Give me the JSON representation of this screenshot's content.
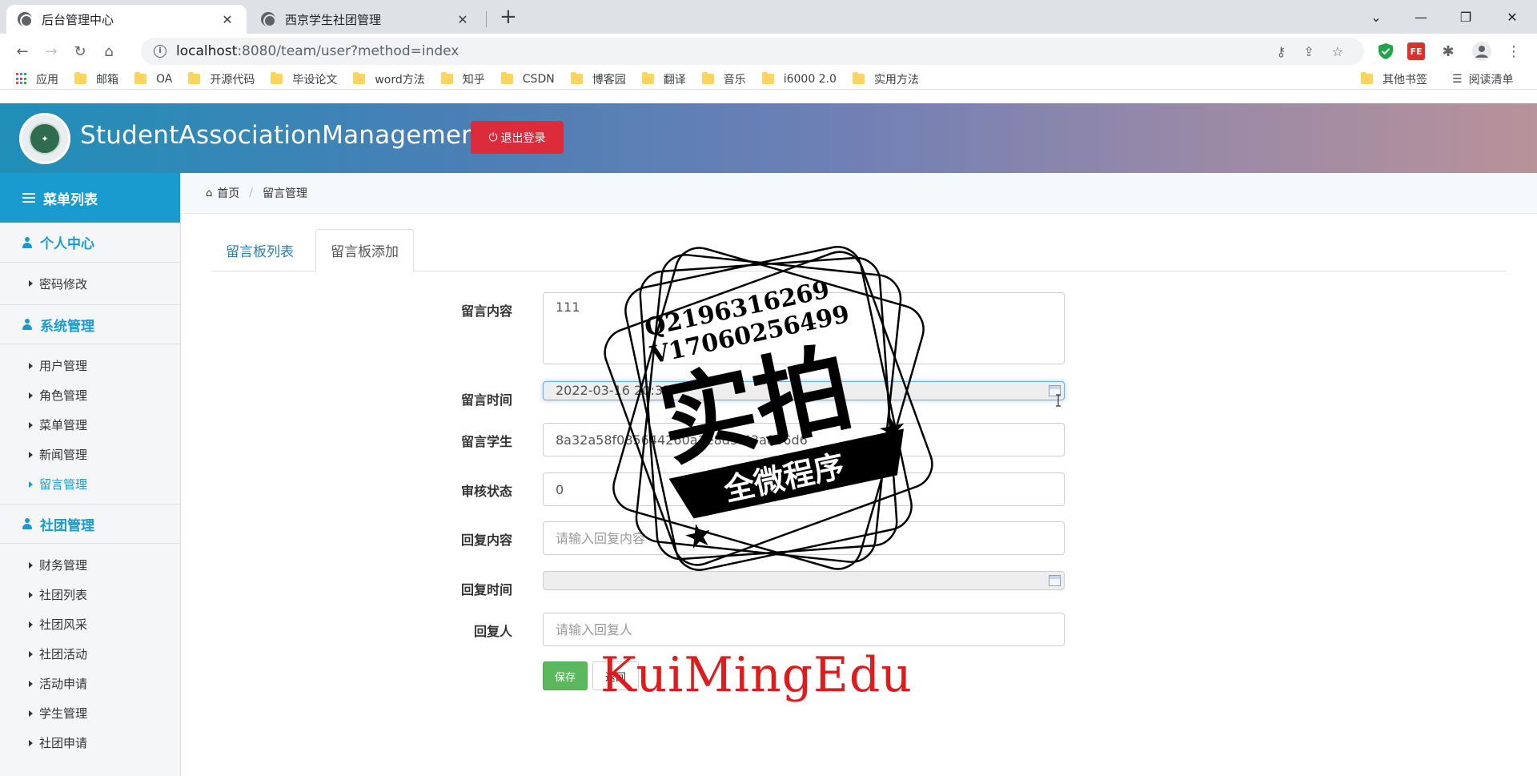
{
  "browser": {
    "tabs": [
      {
        "title": "后台管理中心",
        "active": true
      },
      {
        "title": "西京学生社团管理",
        "active": false
      }
    ],
    "url_host": "localhost",
    "url_path": ":8080/team/user?method=index",
    "bookmarks": [
      "应用",
      "邮箱",
      "OA",
      "开源代码",
      "毕设论文",
      "word方法",
      "知乎",
      "CSDN",
      "博客园",
      "翻译",
      "音乐",
      "i6000 2.0",
      "实用方法"
    ],
    "bookmarks_right": [
      "其他书签",
      "阅读清单"
    ],
    "ext_fe": "FE"
  },
  "header": {
    "brand": "StudentAssociationManagement",
    "logout_label": "退出登录"
  },
  "sidebar": {
    "menu_title": "菜单列表",
    "groups": [
      {
        "title": "个人中心",
        "items": [
          "密码修改"
        ]
      },
      {
        "title": "系统管理",
        "items": [
          "用户管理",
          "角色管理",
          "菜单管理",
          "新闻管理",
          "留言管理"
        ]
      },
      {
        "title": "社团管理",
        "items": [
          "财务管理",
          "社团列表",
          "社团风采",
          "社团活动",
          "活动申请",
          "学生管理",
          "社团申请"
        ]
      }
    ],
    "active_item": "留言管理"
  },
  "breadcrumb": {
    "home": "首页",
    "current": "留言管理"
  },
  "tabs": {
    "list": "留言板列表",
    "add": "留言板添加"
  },
  "form": {
    "content_label": "留言内容",
    "content_value": "111",
    "time_label": "留言时间",
    "time_value": "2022-03-16 20:35",
    "student_label": "留言学生",
    "student_value": "8a32a58f085644260a1e8d3f43a866d6",
    "status_label": "审核状态",
    "status_value": "0",
    "reply_label": "回复内容",
    "reply_placeholder": "请输入回复内容",
    "reply_time_label": "回复时间",
    "replier_label": "回复人",
    "replier_placeholder": "请输入回复人",
    "save_label": "保存",
    "back_label": "返回"
  },
  "watermark": {
    "stamp_line1": "Q2196316269",
    "stamp_line2": "V17060256499",
    "stamp_big": "实拍",
    "stamp_banner": "全微程序",
    "red_text": "KuiMingEdu"
  },
  "colors": {
    "primary": "#1a9bd0",
    "danger": "#dc2b3a",
    "success": "#5cb85c"
  }
}
